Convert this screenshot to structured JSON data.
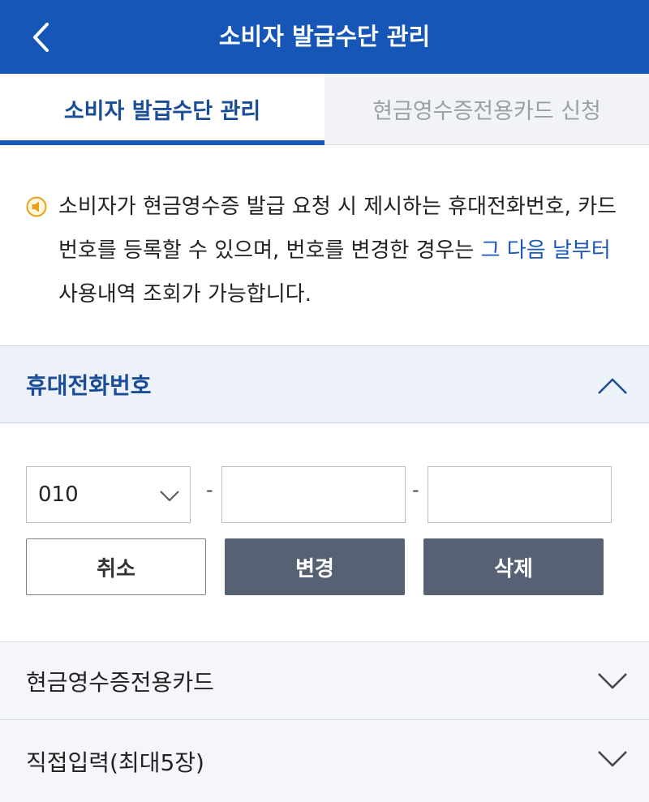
{
  "header": {
    "title": "소비자 발급수단 관리",
    "back_icon": "chevron-left-icon"
  },
  "tabs": [
    {
      "label": "소비자 발급수단 관리",
      "active": true
    },
    {
      "label": "현금영수증전용카드 신청",
      "active": false
    }
  ],
  "notice": {
    "icon": "speaker-icon",
    "text_part1": "소비자가 현금영수증 발급 요청 시 제시하는 휴대전화번호, 카드번호를 등록할 수 있으며, 번호를 변경한 경우는 ",
    "highlight": "그 다음 날부터",
    "text_part2": " 사용내역 조회가 가능합니다."
  },
  "sections": {
    "phone": {
      "title": "휴대전화번호",
      "expanded": true,
      "prefix_value": "010",
      "separator": "-",
      "middle_value": "",
      "last_value": "",
      "buttons": {
        "cancel": "취소",
        "change": "변경",
        "delete": "삭제"
      }
    },
    "card": {
      "title": "현금영수증전용카드",
      "expanded": false
    },
    "direct": {
      "title": "직접입력(최대5장)",
      "expanded": false
    }
  },
  "colors": {
    "primary": "#1656b6",
    "active_text": "#1a4c97",
    "button_dark": "#576174",
    "highlight": "#1a57b8",
    "notice_icon": "#e8a21a"
  }
}
